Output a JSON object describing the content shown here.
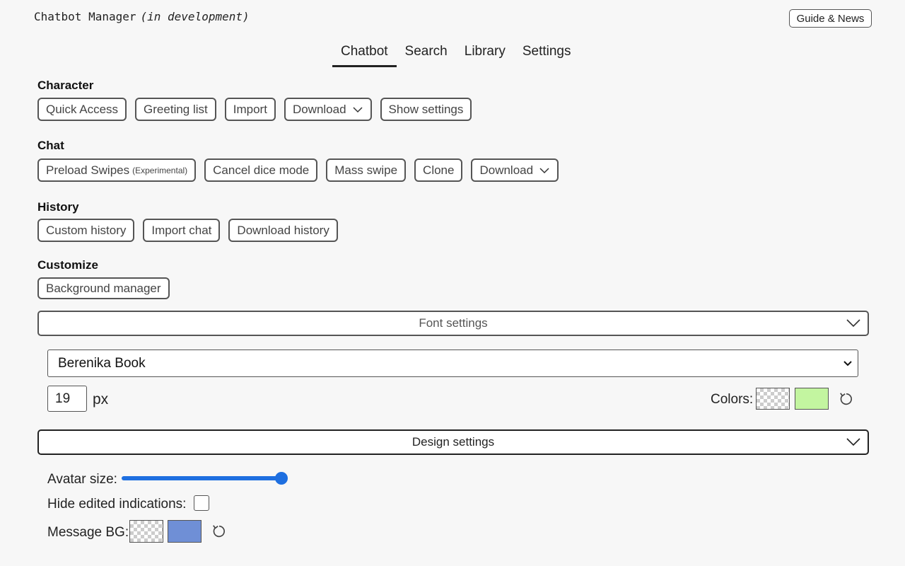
{
  "header": {
    "title": "Chatbot Manager",
    "subtitle": "(in development)",
    "guide_button": "Guide & News"
  },
  "tabs": [
    {
      "label": "Chatbot",
      "active": true
    },
    {
      "label": "Search",
      "active": false
    },
    {
      "label": "Library",
      "active": false
    },
    {
      "label": "Settings",
      "active": false
    }
  ],
  "character": {
    "label": "Character",
    "quick_access": "Quick Access",
    "greeting_list": "Greeting list",
    "import": "Import",
    "download": "Download",
    "show_settings": "Show settings"
  },
  "chat": {
    "label": "Chat",
    "preload_swipes": "Preload Swipes",
    "preload_tag": "(Experimental)",
    "cancel_dice": "Cancel dice mode",
    "mass_swipe": "Mass swipe",
    "clone": "Clone",
    "download": "Download"
  },
  "history": {
    "label": "History",
    "custom_history": "Custom history",
    "import_chat": "Import chat",
    "download_history": "Download history"
  },
  "customize": {
    "label": "Customize",
    "background_manager": "Background manager"
  },
  "font_settings": {
    "title": "Font settings",
    "font": "Berenika Book",
    "size": "19",
    "unit": "px",
    "colors_label": "Colors:",
    "color_text": "#c3f5a0"
  },
  "design_settings": {
    "title": "Design settings",
    "avatar_size_label": "Avatar size:",
    "avatar_size_value": 1.0,
    "hide_edited_label": "Hide edited indications:",
    "hide_edited_checked": false,
    "message_bg_label": "Message BG:",
    "message_bg_color": "#6f8fd6"
  },
  "colors": {
    "accent": "#1e6fe0"
  }
}
